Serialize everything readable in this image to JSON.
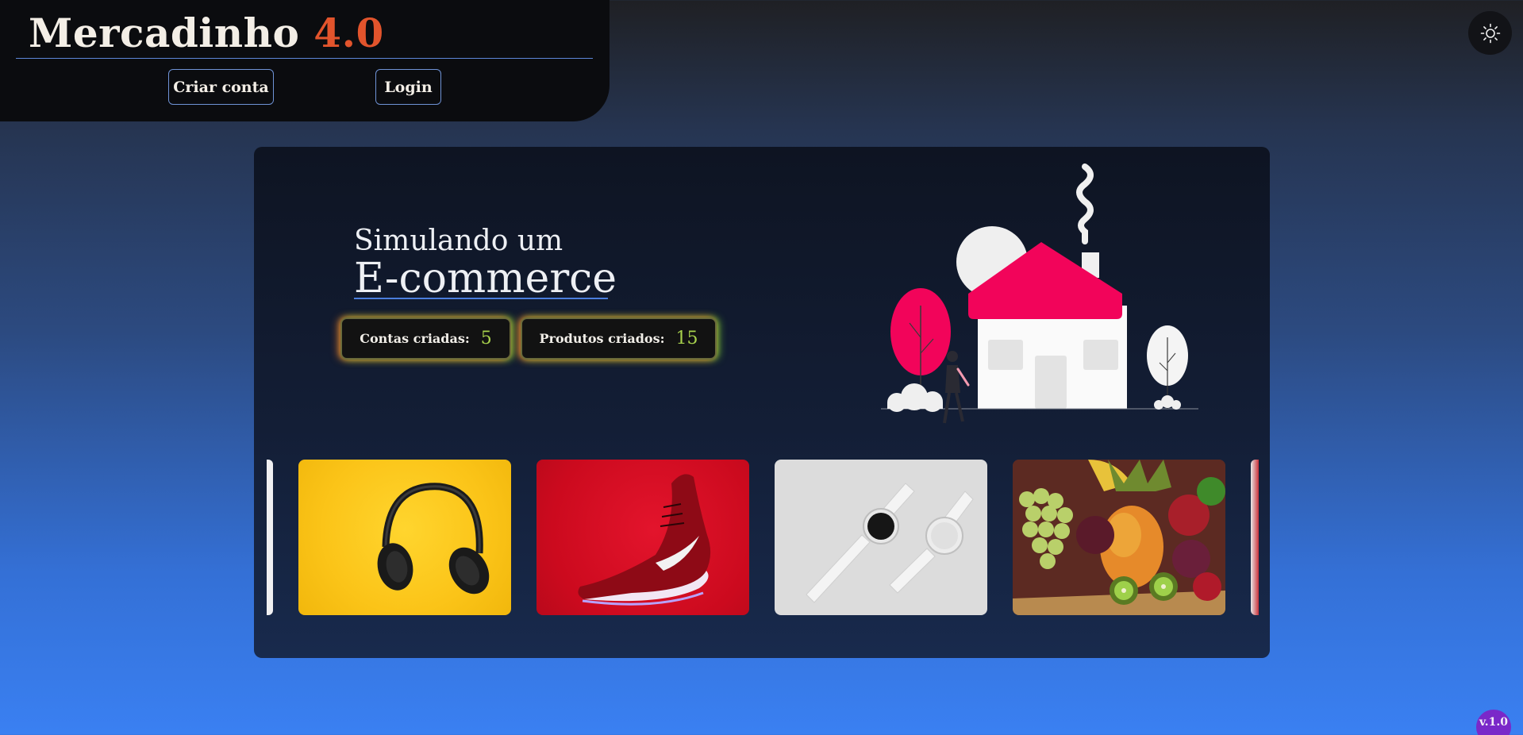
{
  "header": {
    "brand_name": "Mercadinho",
    "brand_version": "4.0",
    "create_account_label": "Criar conta",
    "login_label": "Login"
  },
  "theme_toggle": {
    "icon": "sun-icon"
  },
  "hero": {
    "line1": "Simulando um",
    "line2": "E-commerce"
  },
  "stats": {
    "accounts_label": "Contas criadas:",
    "accounts_value": "5",
    "products_label": "Produtos criados:",
    "products_value": "15"
  },
  "carousel": {
    "items": [
      {
        "icon": "headphones-image"
      },
      {
        "icon": "sneaker-image"
      },
      {
        "icon": "smartwatch-image"
      },
      {
        "icon": "fruits-image"
      }
    ]
  },
  "footer": {
    "version": "v.1.0"
  },
  "colors": {
    "accent_orange": "#e2542c",
    "counter_value": "#a7d14c",
    "version_badge": "#7a28c9",
    "house_roof": "#f2045a"
  }
}
